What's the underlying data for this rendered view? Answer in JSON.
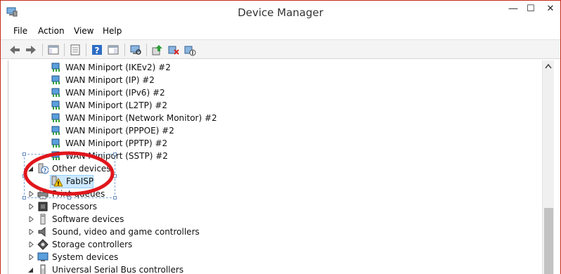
{
  "window": {
    "title": "Device Manager",
    "minimize_glyph": "—",
    "maximize_glyph": "☐",
    "close_glyph": "✕"
  },
  "menu": {
    "file": "File",
    "action": "Action",
    "view": "View",
    "help": "Help"
  },
  "toolbar": {
    "buttons": [
      "back-icon",
      "forward-icon",
      "show-hide-console-tree-icon",
      "properties-icon",
      "help-icon",
      "action-pane-icon",
      "scan-hardware-icon",
      "update-driver-icon",
      "uninstall-icon",
      "disable-icon"
    ]
  },
  "tree": {
    "wan_items": [
      "WAN Miniport (IKEv2) #2",
      "WAN Miniport (IP) #2",
      "WAN Miniport (IPv6) #2",
      "WAN Miniport (L2TP) #2",
      "WAN Miniport (Network Monitor) #2",
      "WAN Miniport (PPPOE) #2",
      "WAN Miniport (PPTP) #2",
      "WAN Miniport (SSTP) #2"
    ],
    "other_devices": "Other devices",
    "fabisp": "FabISP",
    "print_queues": "Print queues",
    "categories": [
      "Processors",
      "Software devices",
      "Sound, video and game controllers",
      "Storage controllers",
      "System devices",
      "Universal Serial Bus controllers"
    ]
  },
  "colors": {
    "annotation_red": "#e0161c",
    "selection_blue": "#cce8ff",
    "close_border": "#c42b1c"
  }
}
